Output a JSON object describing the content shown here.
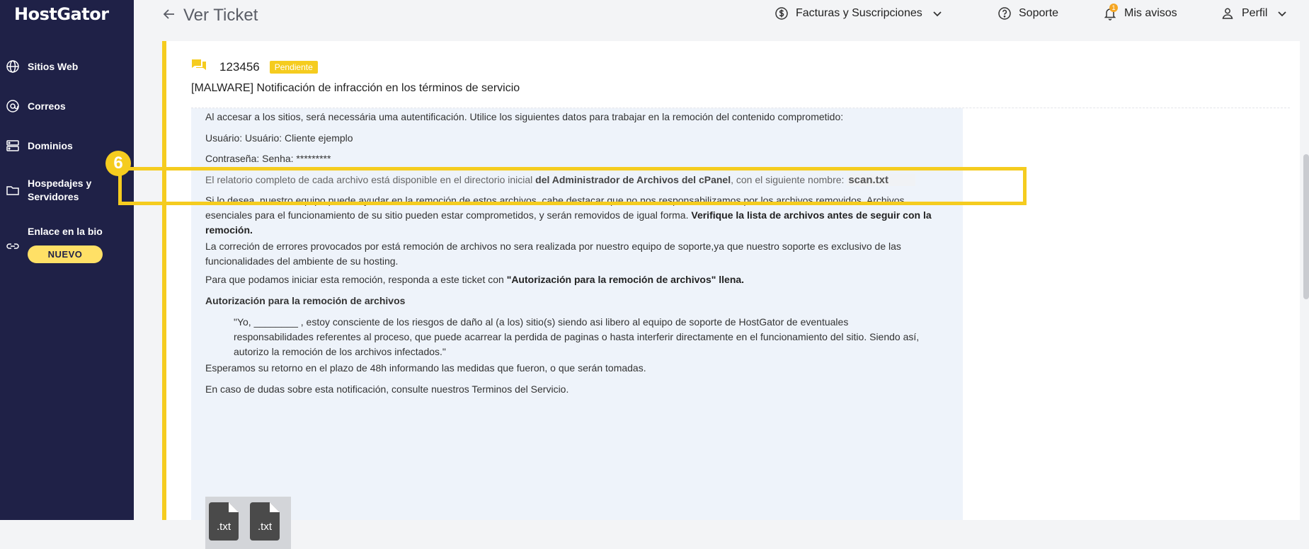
{
  "sidebar": {
    "logo": "HostGator",
    "items": [
      {
        "label": "Sitios Web",
        "icon": "globe-icon"
      },
      {
        "label": "Correos",
        "icon": "at-icon"
      },
      {
        "label": "Dominios",
        "icon": "server-icon"
      },
      {
        "label": "Hospedajes y Servidores",
        "icon": "folder-icon"
      },
      {
        "label": "Enlace en la bio",
        "icon": "link-icon"
      }
    ],
    "badge": "NUEVO"
  },
  "header": {
    "title": "Ver Ticket",
    "billing": "Facturas y Suscripciones",
    "support": "Soporte",
    "notifications": "Mis avisos",
    "notif_count": "1",
    "profile": "Perfil"
  },
  "ticket": {
    "number": "123456",
    "status": "Pendiente",
    "subject": "[MALWARE] Notificación de infracción en los términos de servicio"
  },
  "message": {
    "p1": "Al accesar a los sitios, será necessária uma autentificación. Utilice los siguientes datos para trabajar en la remoción del contenido comprometido:",
    "p2": "Usuário: Usuário: Cliente ejemplo",
    "p3": "Contraseña: Senha: *********",
    "p4a": "El relatorio completo de cada archivo está disponible en el directorio inicial ",
    "p4b": "del Administrador de Archivos del cPanel",
    "p4c": ", con el siguiente nombre: ",
    "p4d": "scan.txt",
    "p5a": "Si lo desea, nuestro equipo puede ayudar en la remoción de estos archivos, cabe destacar que no nos responsabilizamos por los archivos removidos. Archivos esenciales para el funcionamiento de su sitio pueden estar comprometidos, y serán removidos de igual forma. ",
    "p5b": "Verifique la lista de archivos antes de seguir con la remoción.",
    "p6": "La correción de errores provocados por está remoción de archivos no sera realizada por nuestro equipo de soporte,ya que nuestro soporte es exclusivo de las funcionalidades del ambiente de su hosting.",
    "p7a": "Para que podamos iniciar esta remoción, responda a este ticket con ",
    "p7b": "\"Autorización para la remoción de archivos\" llena.",
    "p8": "Autorización para la remoción de archivos",
    "quote": "\"Yo, ________ , estoy consciente de los riesgos de daño al (a los) sitio(s) siendo asi libero al equipo de soporte de HostGator de eventuales responsabilidades referentes al proceso, que puede acarrear la perdida de paginas o hasta interferir directamente en el funcionamiento del sitio. Siendo así, autorizo la remoción de los archivos infectados.\"",
    "p9": "Esperamos su retorno en el plazo de 48h informando las medidas que fueron, o que serán tomadas.",
    "p10": "En caso de dudas sobre esta notificación, consulte nuestros Terminos del Servicio.",
    "attachments": [
      ".txt",
      ".txt"
    ]
  },
  "step_marker": "6",
  "colors": {
    "accent": "#f5cc1f",
    "sidebar": "#1f2147",
    "message_bg": "#eef3fa"
  }
}
